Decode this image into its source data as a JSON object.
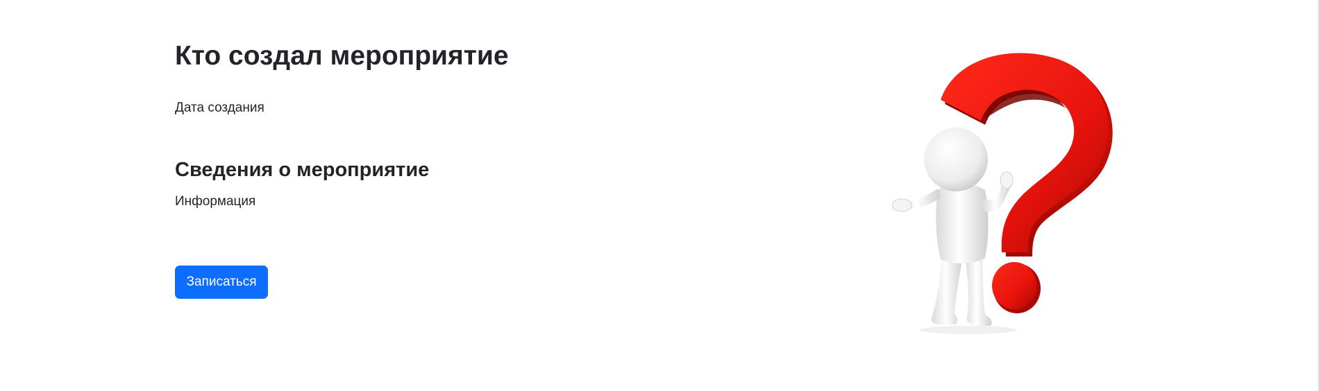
{
  "event": {
    "title": "Кто создал мероприятие",
    "created_label": "Дата создания",
    "details_heading": "Сведения о мероприятие",
    "info_text": "Информация"
  },
  "actions": {
    "signup_label": "Записаться"
  },
  "colors": {
    "primary_button": "#0d6efd",
    "question_mark": "#e8130c",
    "figure": "#f2f2f2"
  },
  "illustration": {
    "icon": "question-mark-figure-icon"
  }
}
